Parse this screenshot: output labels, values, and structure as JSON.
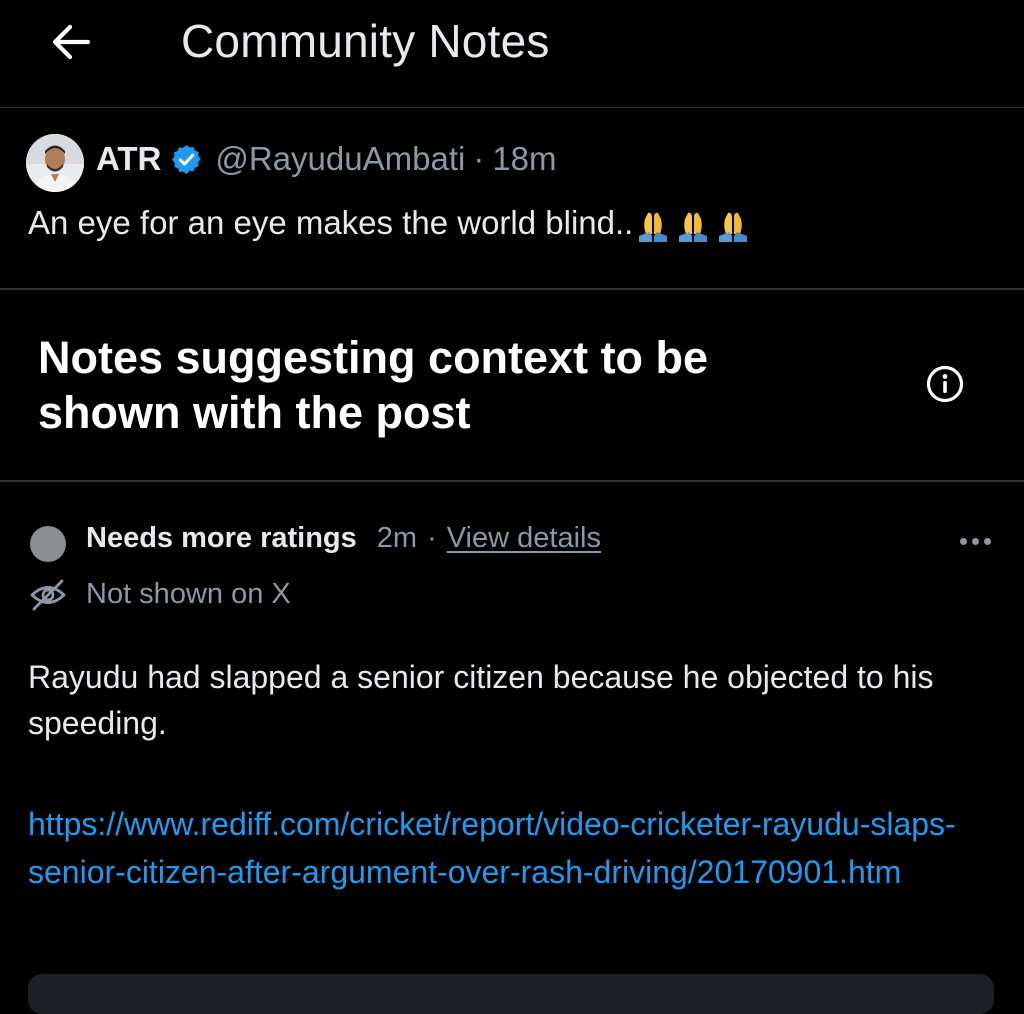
{
  "header": {
    "title": "Community Notes"
  },
  "post": {
    "author_name": "ATR",
    "handle": "@RayuduAmbati",
    "separator": "·",
    "time": "18m",
    "text": "An eye for an eye makes the world blind..",
    "emoji": [
      "🙏",
      "🙏",
      "🙏"
    ]
  },
  "notes_section": {
    "title": "Notes suggesting context to be shown with the post"
  },
  "note": {
    "status": "Needs more ratings",
    "time": "2m",
    "separator": "·",
    "view_details": "View details",
    "visibility": "Not shown on X",
    "body": "Rayudu had slapped a senior citizen because he objected to his speeding.",
    "link": "https://www.rediff.com/cricket/report/video-cricketer-rayudu-slaps-senior-citizen-after-argument-over-rash-driving/20170901.htm"
  },
  "icons": {
    "back": "arrow-left-icon",
    "verified": "verified-badge-icon",
    "info": "info-icon",
    "more": "more-horizontal-icon",
    "not_shown": "eye-slash-icon"
  },
  "colors": {
    "background": "#000000",
    "text": "#e7e9ea",
    "muted": "#8b98a5",
    "link": "#1d9bf0",
    "verified": "#1d9bf0",
    "status_dot": "#8b8f94"
  }
}
